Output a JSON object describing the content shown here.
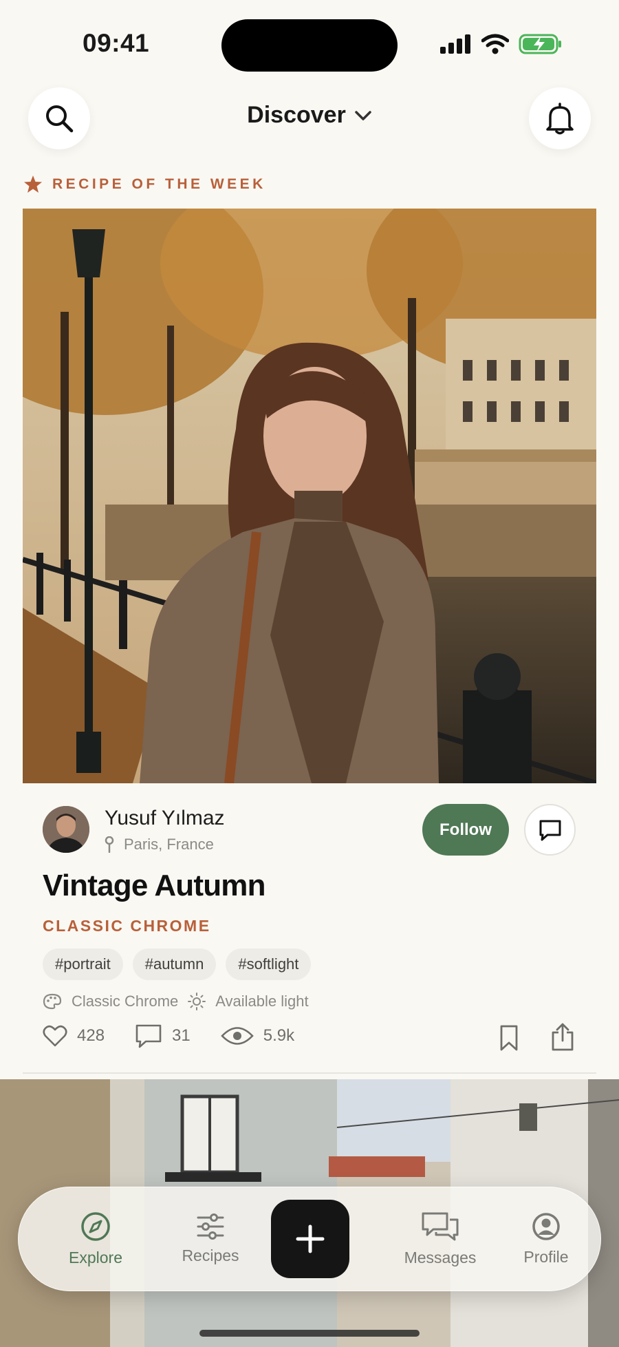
{
  "status_bar": {
    "time": "09:41"
  },
  "header": {
    "title": "Discover"
  },
  "featured": {
    "label": "RECIPE OF THE WEEK",
    "author": {
      "name": "Yusuf Yılmaz",
      "location": "Paris, France"
    },
    "follow_label": "Follow",
    "title": "Vintage Autumn",
    "film_simulation": "CLASSIC CHROME",
    "tags": [
      "#portrait",
      "#autumn",
      "#softlight"
    ],
    "meta": {
      "simulation": "Classic Chrome",
      "lighting": "Available light"
    },
    "stats": {
      "likes": "428",
      "comments": "31",
      "views": "5.9k"
    }
  },
  "tabs": [
    {
      "label": "Explore",
      "icon": "compass-icon",
      "active": true
    },
    {
      "label": "Recipes",
      "icon": "sliders-icon",
      "active": false
    },
    {
      "label": "Messages",
      "icon": "chat-bubbles-icon",
      "active": false
    },
    {
      "label": "Profile",
      "icon": "person-circle-icon",
      "active": false
    }
  ],
  "colors": {
    "accent": "#b8603a",
    "brand": "#4f7855",
    "background": "#faf8f3"
  }
}
